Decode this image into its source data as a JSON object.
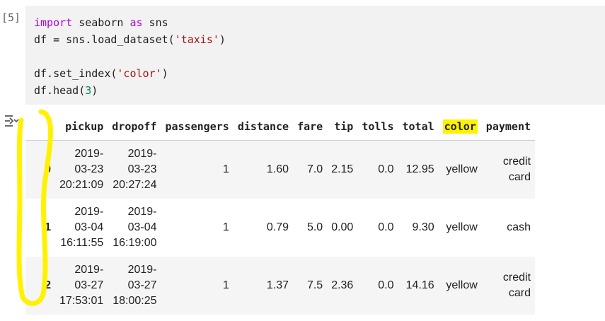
{
  "cell": {
    "prompt": "[5]",
    "code": {
      "line1_kw_import": "import",
      "line1_mid": " seaborn ",
      "line1_kw_as": "as",
      "line1_end": " sns",
      "line2_pre": "df = sns.load_dataset(",
      "line2_str": "'taxis'",
      "line2_end": ")",
      "line4_pre": "df.set_index(",
      "line4_str": "'color'",
      "line4_end": ")",
      "line5_pre": "df.head(",
      "line5_num": "3",
      "line5_end": ")"
    }
  },
  "output": {
    "columns": [
      "pickup",
      "dropoff",
      "passengers",
      "distance",
      "fare",
      "tip",
      "tolls",
      "total",
      "color",
      "payment"
    ],
    "highlighted_column": "color",
    "rows": [
      {
        "index": "0",
        "pickup": [
          "2019-",
          "03-23",
          "20:21:09"
        ],
        "dropoff": [
          "2019-",
          "03-23",
          "20:27:24"
        ],
        "passengers": "1",
        "distance": "1.60",
        "fare": "7.0",
        "tip": "2.15",
        "tolls": "0.0",
        "total": "12.95",
        "color": "yellow",
        "payment": [
          "credit",
          "card"
        ]
      },
      {
        "index": "1",
        "pickup": [
          "2019-",
          "03-04",
          "16:11:55"
        ],
        "dropoff": [
          "2019-",
          "03-04",
          "16:19:00"
        ],
        "passengers": "1",
        "distance": "0.79",
        "fare": "5.0",
        "tip": "0.00",
        "tolls": "0.0",
        "total": "9.30",
        "color": "yellow",
        "payment": [
          "cash"
        ]
      },
      {
        "index": "2",
        "pickup": [
          "2019-",
          "03-27",
          "17:53:01"
        ],
        "dropoff": [
          "2019-",
          "03-27",
          "18:00:25"
        ],
        "passengers": "1",
        "distance": "1.37",
        "fare": "7.5",
        "tip": "2.36",
        "tolls": "0.0",
        "total": "14.16",
        "color": "yellow",
        "payment": [
          "credit",
          "card"
        ]
      }
    ]
  },
  "colors": {
    "highlight": "#fff200",
    "keyword": "#af00db",
    "string": "#a31515",
    "number": "#098658"
  },
  "icons": {
    "output_toggle": "output-collapse-icon"
  }
}
